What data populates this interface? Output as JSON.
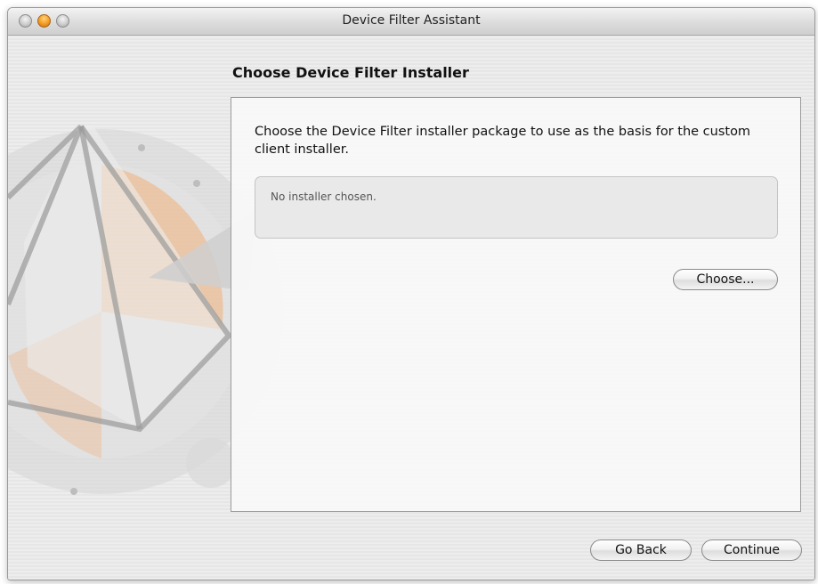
{
  "window": {
    "title": "Device Filter Assistant"
  },
  "step": {
    "title": "Choose Device Filter Installer"
  },
  "panel": {
    "instructions": "Choose the Device Filter installer package to use as the basis for the custom client installer.",
    "installer_path": "No installer chosen.",
    "choose_label": "Choose..."
  },
  "footer": {
    "back_label": "Go Back",
    "continue_label": "Continue"
  },
  "colors": {
    "minimize_button": "#f29b21",
    "art_orange": "#f0b07a"
  }
}
